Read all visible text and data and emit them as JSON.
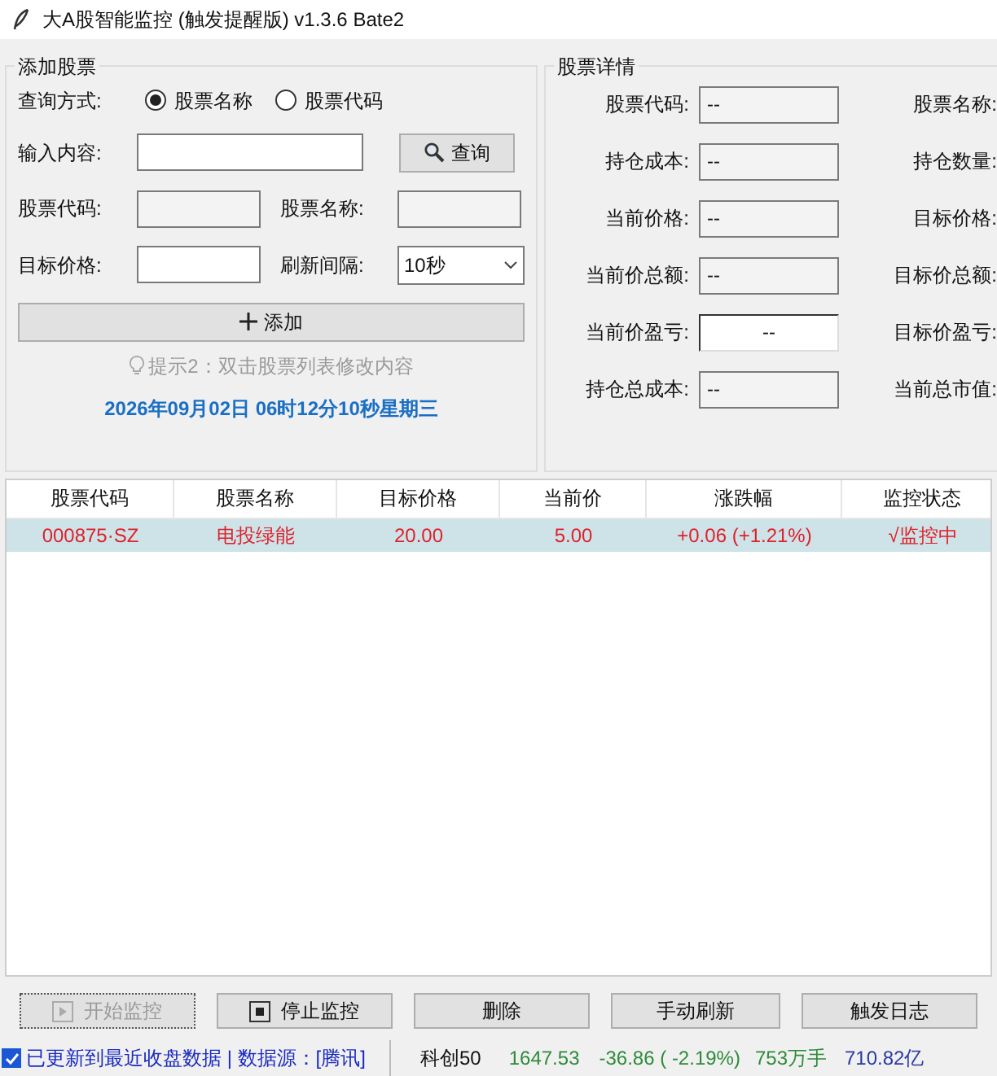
{
  "window": {
    "title": "大A股智能监控 (触发提醒版) v1.3.6 Bate2"
  },
  "add_stock": {
    "title": "添加股票",
    "query_mode": {
      "label": "查询方式:",
      "options": [
        {
          "label": "股票名称",
          "selected": true
        },
        {
          "label": "股票代码",
          "selected": false
        }
      ]
    },
    "input": {
      "label": "输入内容:"
    },
    "query_button": "查询",
    "code": {
      "label": "股票代码:"
    },
    "name": {
      "label": "股票名称:"
    },
    "target": {
      "label": "目标价格:"
    },
    "interval": {
      "label": "刷新间隔:",
      "value": "10秒"
    },
    "add_button": "添加",
    "hint": "提示2：双击股票列表修改内容",
    "datetime": "2026年09月02日 06时12分10秒星期三"
  },
  "details": {
    "title": "股票详情",
    "rows": [
      {
        "left_label": "股票代码:",
        "left_value": "--",
        "focused": false,
        "right_label": "股票名称:"
      },
      {
        "left_label": "持仓成本:",
        "left_value": "--",
        "focused": false,
        "right_label": "持仓数量:"
      },
      {
        "left_label": "当前价格:",
        "left_value": "--",
        "focused": false,
        "right_label": "目标价格:"
      },
      {
        "left_label": "当前价总额:",
        "left_value": "--",
        "focused": false,
        "right_label": "目标价总额:"
      },
      {
        "left_label": "当前价盈亏:",
        "left_value": "--",
        "focused": true,
        "right_label": "目标价盈亏:"
      },
      {
        "left_label": "持仓总成本:",
        "left_value": "--",
        "focused": false,
        "right_label": "当前总市值:"
      }
    ]
  },
  "table": {
    "columns": [
      "股票代码",
      "股票名称",
      "目标价格",
      "当前价",
      "涨跌幅",
      "监控状态"
    ],
    "rows": [
      {
        "cells": [
          "000875·SZ",
          "电投绿能",
          "20.00",
          "5.00",
          "+0.06 (+1.21%)",
          "√监控中"
        ],
        "selected": true
      }
    ]
  },
  "buttons": [
    {
      "label": "开始监控",
      "kind": "start",
      "disabled": true
    },
    {
      "label": "停止监控",
      "kind": "stop",
      "disabled": false
    },
    {
      "label": "删除",
      "kind": "plain",
      "disabled": false
    },
    {
      "label": "手动刷新",
      "kind": "plain",
      "disabled": false
    },
    {
      "label": "触发日志",
      "kind": "plain",
      "disabled": false
    }
  ],
  "status_bar": {
    "checked": true,
    "message": "已更新到最近收盘数据 | 数据源：[腾讯]",
    "index": {
      "name": "科创50",
      "price": "1647.53",
      "change": "-36.86 ( -2.19%)",
      "volume": "753万手",
      "amount": "710.82亿"
    }
  }
}
